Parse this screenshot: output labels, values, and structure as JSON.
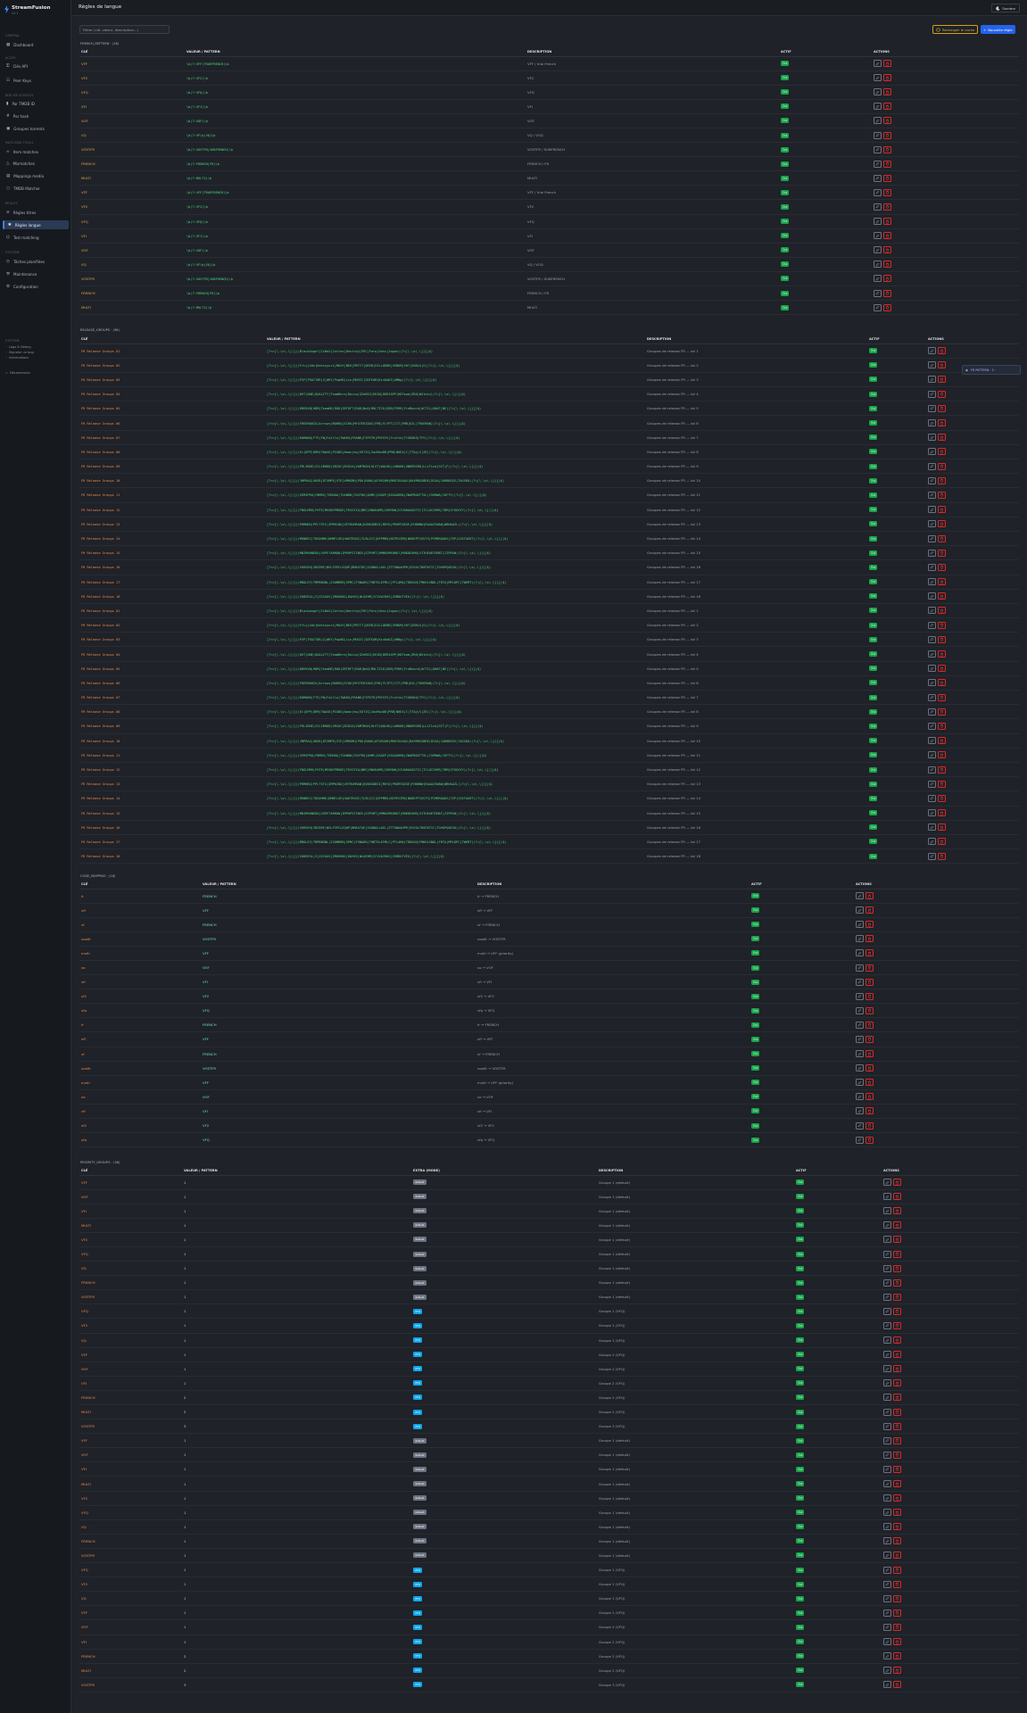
{
  "app": {
    "name": "StreamFusion",
    "version": "v2.1",
    "page_title": "Règles de langue",
    "theme_label": "Sombre"
  },
  "sidebar": {
    "sections": [
      {
        "label": "Général",
        "items": [
          {
            "label": "Dashboard",
            "icon": "dashboard-icon"
          }
        ]
      },
      {
        "label": "Accès",
        "items": [
          {
            "label": "Clés API",
            "icon": "key-icon"
          },
          {
            "label": "Peer Keys",
            "icon": "users-icon"
          }
        ]
      },
      {
        "label": "Bdd de sources",
        "items": [
          {
            "label": "Par TMDB ID",
            "icon": "film-icon"
          },
          {
            "label": "Par hash",
            "icon": "hash-icon"
          },
          {
            "label": "Groupes torrents",
            "icon": "box-icon"
          }
        ]
      },
      {
        "label": "Matching tools",
        "items": [
          {
            "label": "Item matches",
            "icon": "link-icon"
          },
          {
            "label": "Mismatches",
            "icon": "warning-icon"
          },
          {
            "label": "Mappings media",
            "icon": "map-icon"
          },
          {
            "label": "TMDB Matcher",
            "icon": "search-icon"
          }
        ]
      },
      {
        "label": "Règles",
        "items": [
          {
            "label": "Règles titres",
            "icon": "rule-icon"
          },
          {
            "label": "Règles langue",
            "icon": "language-icon",
            "active": true
          },
          {
            "label": "Test matching",
            "icon": "test-icon"
          }
        ]
      },
      {
        "label": "Système",
        "items": [
          {
            "label": "Tâches planifiées",
            "icon": "clock-icon"
          },
          {
            "label": "Maintenance",
            "icon": "wrench-icon"
          },
          {
            "label": "Configuration",
            "icon": "gear-icon"
          }
        ]
      }
    ],
    "footer_section": "Système",
    "footer_links": [
      "Logs & Debug",
      "Signaler un bug",
      "Informations"
    ],
    "logout": "Déconnexion"
  },
  "toolbar": {
    "filter_placeholder": "Filtrer (clé, valeur, description...)",
    "reload_label": "Recharger le cache",
    "new_label": "Nouvelle règle"
  },
  "floating": {
    "label": "FR PATTERN · 2 ·"
  },
  "french_pattern": {
    "title": "FRENCH_PATTERN · (18)",
    "headers": [
      "CLÉ",
      "VALEUR / PATTERN",
      "DESCRIPTION",
      "ACTIF",
      "ACTIONS"
    ],
    "rows": [
      [
        "VFF",
        "\\b(?:VFF|TRUEFRENCH)\\b",
        "VFF / Vrai French",
        "Oui"
      ],
      [
        "VF2",
        "\\b(?:VF2)\\b",
        "VF2",
        "Oui"
      ],
      [
        "VFQ",
        "\\b(?:VFQ)\\b",
        "VFQ",
        "Oui"
      ],
      [
        "VFI",
        "\\b(?:VFI)\\b",
        "VFI",
        "Oui"
      ],
      [
        "VOF",
        "\\b(?:VOF)\\b",
        "VOF",
        "Oui"
      ],
      [
        "VQ",
        "\\b(?:VF\\b|VQ)\\b",
        "VQ / VOQ",
        "Oui"
      ],
      [
        "VOSTFR",
        "\\b(?:VOSTFR|SUBFRENCH)\\b",
        "VOSTFR / SUBFRENCH",
        "Oui"
      ],
      [
        "FRENCH",
        "\\b(?:FRENCH|FR)\\b",
        "FRENCH / FR",
        "Oui"
      ],
      [
        "MULTI",
        "\\b(?:MULTI)\\b",
        "MULTI",
        "Oui"
      ],
      [
        "VFF",
        "\\b(?:VFF|TRUEFRENCH)\\b",
        "VFF / Vrai French",
        "Oui"
      ],
      [
        "VF2",
        "\\b(?:VF2)\\b",
        "VF2",
        "Oui"
      ],
      [
        "VFQ",
        "\\b(?:VFQ)\\b",
        "VFQ",
        "Oui"
      ],
      [
        "VFI",
        "\\b(?:VFI)\\b",
        "VFI",
        "Oui"
      ],
      [
        "VOF",
        "\\b(?:VOF)\\b",
        "VOF",
        "Oui"
      ],
      [
        "VQ",
        "\\b(?:VF\\b|VQ)\\b",
        "VQ / VOQ",
        "Oui"
      ],
      [
        "VOSTFR",
        "\\b(?:VOSTFR|SUBFRENCH)\\b",
        "VOSTFR / SUBFRENCH",
        "Oui"
      ],
      [
        "FRENCH",
        "\\b(?:FRENCH|FR)\\b",
        "FRENCH / FR",
        "Oui"
      ],
      [
        "MULTI",
        "\\b(?:MULTI)\\b",
        "MULTI",
        "Oui"
      ]
    ]
  },
  "release_groups": {
    "title": "RELEASE_GROUPS · (36)",
    "headers": [
      "CLÉ",
      "VALEUR / PATTERN",
      "DESCRIPTION",
      "ACTIF",
      "ACTIONS"
    ],
    "rows": [
      [
        "FR Release Groups 01",
        "[?<=[\\.\\s\\-\\[(])(BlackAngel|CiNeX|Cortex|Destroy|FRC|Fero|Genz|Japon)(?=[\\.\\s\\-\\])]|$)",
        "Groupes de release FR — lot 1",
        "Oui"
      ],
      [
        "FR Release Groups 02",
        "[?<=[\\.\\s\\-\\[(])(FrLy|Gdn|Katsuyuri|MAXY|NEO|PRTCT|QEEB|SILLQEBB|VENUM|SHT|XORiG|S)(?=[\\.\\s\\-\\])]|$)",
        "Groupes de release FR — lot 2",
        "Oui"
      ],
      [
        "FR Release Groups 03",
        "[?<=[\\.\\s\\-\\[(])(P2P|TRAIT0R|Z|WKY|PopHD|Lin|MUSIC|SDTEAM|KisKaDI|AMNg)(?=[\\.\\s\\-\\])]|$)",
        "Groupes de release FR — lot 3",
        "Oui"
      ],
      [
        "FR Release Groups 04",
        "[?<=[\\.\\s\\-\\[(])(DHT|ONE|QUALITY|TeamBers|Rocco|GZeBIX|EKIN|DERIAPP|HDTeam|ZRO|WStein)(?=[\\.\\s\\-\\])]|$)",
        "Groupes de release FR — lot 4",
        "Oui"
      ],
      [
        "FR Release Groups 05",
        "[?<=[\\.\\s\\-\\[(])(DREKVN|HDM|TeamHD|ROD|GRTDFT|RAR|NeO|MULTICO|SDB|PVRR|FreBoard|ACTIL|ONAT|NE)(?=[\\.\\s\\-\\])]|$)",
        "Groupes de release FR — lot 5",
        "Oui"
      ],
      [
        "FR Release Groups 06",
        "[?<=[\\.\\s\\-\\[(])(FREEMARIO|Arrows|MARRQ|ECHO|MYSTERIOUS|FME|FLYPT|CIT|FMB|DIL|TRUEMAN)(?=[\\.\\s\\-\\])]|$)",
        "Groupes de release FR — lot 6",
        "Oui"
      ],
      [
        "FR Release Groups 07",
        "[?<=[\\.\\s\\-\\[(])(ROMANO|FTS|FW|Faillo|TWAKO|FRANK|FIPSTR|PHYSYS|Frutta|TIGKOKO|TFS)(?=[\\.\\s\\-\\])]|$)",
        "Groupes de release FR — lot 7",
        "Oui"
      ],
      [
        "FR Release Groups 08",
        "[?<=[\\.\\s\\-\\[(])(Ec|DPP|DRM|TWASK|PIGBO|Amanjew|EOTIG|ZaxMonDB|PRB|NHEX|C|TTAy|S|ZE)(?=[\\.\\s\\-\\])]|$)",
        "Groupes de release FR — lot 8",
        "Oui"
      ],
      [
        "FR Release Groups 09",
        "[?<=[\\.\\s\\-\\[(])(FRLIBOE|CCLIBHDD|GRIOC|BCDIA|VAMTNSH|ULVT|WOLHO|LAMANE|UNDERGRD|LLLTLnd|SIT|F)(?=[\\.\\s\\-\\])]|$)",
        "Groupes de release FR — lot 9",
        "Oui"
      ],
      [
        "FR Release Groups 10",
        "[?<=[\\.\\s\\-\\[(])(JMPRAX|ARGR|DTXMPE|GTE|VMRGBH|PDO|RANG|AFVRZAM|RMOTAVAQX|RAYMRXXBDE|DCOA|CARBBSEX|TAGSDO)(?=[\\.\\s\\-\\])]|$)",
        "Groupes de release FR — lot 10",
        "Oui"
      ],
      [
        "FR Release Groups 11",
        "[?<=[\\.\\s\\-\\[(])(SEMIPRO|FNMRS|TGMUOA|TSANDN|TOXTRO|AHMS|SXAEP|SEAGARMA|ZWAPBOGTTXL|CSHMWA|COFTY)(?=[\\.\\s\\-\\])]|$)",
        "Groupes de release FR — lot 11",
        "Oui"
      ],
      [
        "FR Release Groups 12",
        "[?<=[\\.\\s\\-\\[(])(FNGLMRR|FHTE|MEGNYPMODE|TRIGYIA|NMC|RNGKAMR|CHEMAN|VIVARAGASTIC|TCLUCCHMS|TBM|STUGGYY)(?=[\\.\\s\\-\\])]|$)",
        "Groupes de release FR — lot 12",
        "Oui"
      ],
      [
        "FR Release Groups 13",
        "[?<=[\\.\\s\\-\\[(])(PHMHBX|PPLTSTX|IMPKCNQ|VETHUHRAW|QVDKGDBSI|MUYO|PRUMTAEGE|FHNHBW|RAAACEWAW|WBHAAZL)(?=[\\.\\s\\-\\])]|$)",
        "Groupes de release FR — lot 13",
        "Oui"
      ],
      [
        "FR Release Groups 14",
        "[?<=[\\.\\s\\-\\[(])(MUNDEC|TDGOHMO|OMNTLGR|HAKTRVOI|TLBLCCI|DFPMRU|NCPEVZMU|NODEPTCOVTS|PCMRRQAHX|TEP|CUSTAGHT)(?=[\\.\\s\\-\\])]|$)",
        "Groupes de release FR — lot 14",
        "Oui"
      ],
      [
        "FR Release Groups 15",
        "[?<=[\\.\\s\\-\\[(])(MNIRMUNEDO|VGPETARMAN|IMPOPSTINSV|SZPVMT|VMMAVMEOMAT|MOKDEAMO|VITHEARTSMAT|ZIPRSW)(?=[\\.\\s\\-\\])]|$)",
        "Groupes de release FR — lot 15",
        "Oui"
      ],
      [
        "FR Release Groups 16",
        "[?<=[\\.\\s\\-\\[(])(VUDVEH|SBCDRF|NSLFSPCLEQOP|BMAXTOE|SGONOLLAEL|ZTTONAAHPR|SSVOLTNSPATIC|TOVKPQAESO)(?=[\\.\\s\\-\\])]|$)",
        "Groupes de release FR — lot 16",
        "Oui"
      ],
      [
        "FR Release Groups 17",
        "[?<=[\\.\\s\\-\\[(])(MBOLEY|TMPBBGNL|ISOMBRB|SPMC|FSNAHR|THBTSLEFMLC|PTLAMA|TDRUGH|FMKHLSNDL|FRTA|MPLDPC|TWEMT)(?=[\\.\\s\\-\\])]|$)",
        "Groupes de release FR — lot 17",
        "Oui"
      ],
      [
        "FR Release Groups 18",
        "[?<=[\\.\\s\\-\\[(])(SUBSEGL|Z|ZXCAUS|ZMUUMAS|DAHVS|WLUEHM|CCVVAIRUS|ZXMDUTVEU)(?=[\\.\\s\\-\\])]|$)",
        "Groupes de release FR — lot 18",
        "Oui"
      ],
      [
        "FR Release Groups 01",
        "[?<=[\\.\\s\\-\\[(])(BlackAngel|CiNeX|Cortex|Destroy|FRC|Fero|Genz|Japon)(?=[\\.\\s\\-\\])]|$)",
        "Groupes de release FR — lot 1",
        "Oui"
      ],
      [
        "FR Release Groups 02",
        "[?<=[\\.\\s\\-\\[(])(FrLy|Gdn|Katsuyuri|MAXY|NEO|PRTCT|QEEB|SILLQEBB|VENUM|SHT|XORiG|S)(?=[\\.\\s\\-\\])]|$)",
        "Groupes de release FR — lot 2",
        "Oui"
      ],
      [
        "FR Release Groups 03",
        "[?<=[\\.\\s\\-\\[(])(P2P|TRAIT0R|Z|WKY|PopHD|Lin|MUSIC|SDTEAM|KisKaDI|AMNg)(?=[\\.\\s\\-\\])]|$)",
        "Groupes de release FR — lot 3",
        "Oui"
      ],
      [
        "FR Release Groups 04",
        "[?<=[\\.\\s\\-\\[(])(DHT|ONE|QUALITY|TeamBers|Rocco|GZeBIX|EKIN|DERIAPP|HDTeam|ZRO|WStein)(?=[\\.\\s\\-\\])]|$)",
        "Groupes de release FR — lot 4",
        "Oui"
      ],
      [
        "FR Release Groups 05",
        "[?<=[\\.\\s\\-\\[(])(DREKVN|HDM|TeamHD|ROD|GRTDFT|RAR|NeO|MULTICO|SDB|PVRR|FreBoard|ACTIL|ONAT|NE)(?=[\\.\\s\\-\\])]|$)",
        "Groupes de release FR — lot 5",
        "Oui"
      ],
      [
        "FR Release Groups 06",
        "[?<=[\\.\\s\\-\\[(])(FREEMARIO|Arrows|MARRQ|ECHO|MYSTERIOUS|FME|FLYPT|CIT|FMB|DIL|TRUEMAN)(?=[\\.\\s\\-\\])]|$)",
        "Groupes de release FR — lot 6",
        "Oui"
      ],
      [
        "FR Release Groups 07",
        "[?<=[\\.\\s\\-\\[(])(ROMANO|FTS|FW|Faillo|TWAKO|FRANK|FIPSTR|PHYSYS|Frutta|TIGKOKO|TFS)(?=[\\.\\s\\-\\])]|$)",
        "Groupes de release FR — lot 7",
        "Oui"
      ],
      [
        "FR Release Groups 08",
        "[?<=[\\.\\s\\-\\[(])(Ec|DPP|DRM|TWASK|PIGBO|Amanjew|EOTIG|ZaxMonDB|PRB|NHEX|C|TTAy|S|ZE)(?=[\\.\\s\\-\\])]|$)",
        "Groupes de release FR — lot 8",
        "Oui"
      ],
      [
        "FR Release Groups 09",
        "[?<=[\\.\\s\\-\\[(])(FRLIBOE|CCLIBHDD|GRIOC|BCDIA|VAMTNSH|ULVT|WOLHO|LAMANE|UNDERGRD|LLLTLnd|SIT|F)(?=[\\.\\s\\-\\])]|$)",
        "Groupes de release FR — lot 9",
        "Oui"
      ],
      [
        "FR Release Groups 10",
        "[?<=[\\.\\s\\-\\[(])(JMPRAX|ARGR|DTXMPE|GTE|VMRGBH|PDO|RANG|AFVRZAM|RMOTAVAQX|RAYMRXXBDE|DCOA|CARBBSEX|TAGSDO)(?=[\\.\\s\\-\\])]|$)",
        "Groupes de release FR — lot 10",
        "Oui"
      ],
      [
        "FR Release Groups 11",
        "[?<=[\\.\\s\\-\\[(])(SEMIPRO|FNMRS|TGMUOA|TSANDN|TOXTRO|AHMS|SXAEP|SEAGARMA|ZWAPBOGTTXL|CSHMWA|COFTY)(?=[\\.\\s\\-\\])]|$)",
        "Groupes de release FR — lot 11",
        "Oui"
      ],
      [
        "FR Release Groups 12",
        "[?<=[\\.\\s\\-\\[(])(FNGLMRR|FHTE|MEGNYPMODE|TRIGYIA|NMC|RNGKAMR|CHEMAN|VIVARAGASTIC|TCLUCCHMS|TBM|STUGGYY)(?=[\\.\\s\\-\\])]|$)",
        "Groupes de release FR — lot 12",
        "Oui"
      ],
      [
        "FR Release Groups 13",
        "[?<=[\\.\\s\\-\\[(])(PHMHBX|PPLTSTX|IMPKCNQ|VETHUHRAW|QVDKGDBSI|MUYO|PRUMTAEGE|FHNHBW|RAAACEWAW|WBHAAZL)(?=[\\.\\s\\-\\])]|$)",
        "Groupes de release FR — lot 13",
        "Oui"
      ],
      [
        "FR Release Groups 14",
        "[?<=[\\.\\s\\-\\[(])(MUNDEC|TDGOHMO|OMNTLGR|HAKTRVOI|TLBLCCI|DFPMRU|NCPEVZMU|NODEPTCOVTS|PCMRRQAHX|TEP|CUSTAGHT)(?=[\\.\\s\\-\\])]|$)",
        "Groupes de release FR — lot 14",
        "Oui"
      ],
      [
        "FR Release Groups 15",
        "[?<=[\\.\\s\\-\\[(])(MNIRMUNEDO|VGPETARMAN|IMPOPSTINSV|SZPVMT|VMMAVMEOMAT|MOKDEAMO|VITHEARTSMAT|ZIPRSW)(?=[\\.\\s\\-\\])]|$)",
        "Groupes de release FR — lot 15",
        "Oui"
      ],
      [
        "FR Release Groups 16",
        "[?<=[\\.\\s\\-\\[(])(VUDVEH|SBCDRF|NSLFSPCLEQOP|BMAXTOE|SGONOLLAEL|ZTTONAAHPR|SSVOLTNSPATIC|TOVKPQAESO)(?=[\\.\\s\\-\\])]|$)",
        "Groupes de release FR — lot 16",
        "Oui"
      ],
      [
        "FR Release Groups 17",
        "[?<=[\\.\\s\\-\\[(])(MBOLEY|TMPBBGNL|ISOMBRB|SPMC|FSNAHR|THBTSLEFMLC|PTLAMA|TDRUGH|FMKHLSNDL|FRTA|MPLDPC|TWEMT)(?=[\\.\\s\\-\\])]|$)",
        "Groupes de release FR — lot 17",
        "Oui"
      ],
      [
        "FR Release Groups 18",
        "[?<=[\\.\\s\\-\\[(])(SUBSEGL|Z|ZXCAUS|ZMUUMAS|DAHVS|WLUEHM|CCVVAIRUS|ZXMDUTVEU)(?=[\\.\\s\\-\\])]|$)",
        "Groupes de release FR — lot 18",
        "Oui"
      ]
    ]
  },
  "code_mapping": {
    "title": "CODE_MAPPING · (18)",
    "headers": [
      "CLÉ",
      "VALEUR / PATTERN",
      "DESCRIPTION",
      "ACTIF",
      "ACTIONS"
    ],
    "rows": [
      [
        "fr",
        "FRENCH",
        "fr → FRENCH",
        "Oui"
      ],
      [
        "vff",
        "VFF",
        "vff → VFF",
        "Oui"
      ],
      [
        "vf",
        "FRENCH",
        "vf → FRENCH",
        "Oui"
      ],
      [
        "vostfr",
        "VOSTFR",
        "vostfr → VOSTFR",
        "Oui"
      ],
      [
        "multi",
        "VFF",
        "multi → VFF (priority)",
        "Oui"
      ],
      [
        "vo",
        "VOF",
        "vo → VOF",
        "Oui"
      ],
      [
        "vfi",
        "VFI",
        "vfi → VFI",
        "Oui"
      ],
      [
        "vf2",
        "VF2",
        "vf2 → VF2",
        "Oui"
      ],
      [
        "vfq",
        "VFQ",
        "vfq → VFQ",
        "Oui"
      ],
      [
        "fr",
        "FRENCH",
        "fr → FRENCH",
        "Oui"
      ],
      [
        "vff",
        "VFF",
        "vff → VFF",
        "Oui"
      ],
      [
        "vf",
        "FRENCH",
        "vf → FRENCH",
        "Oui"
      ],
      [
        "vostfr",
        "VOSTFR",
        "vostfr → VOSTFR",
        "Oui"
      ],
      [
        "multi",
        "VFF",
        "multi → VFF (priority)",
        "Oui"
      ],
      [
        "vo",
        "VOF",
        "vo → VOF",
        "Oui"
      ],
      [
        "vfi",
        "VFI",
        "vfi → VFI",
        "Oui"
      ],
      [
        "vf2",
        "VF2",
        "vf2 → VF2",
        "Oui"
      ],
      [
        "vfq",
        "VFQ",
        "vfq → VFQ",
        "Oui"
      ]
    ]
  },
  "priority_groups": {
    "title": "PRIORITY_GROUPS · (36)",
    "headers": [
      "CLÉ",
      "VALEUR / PATTERN",
      "EXTRA (MODE)",
      "DESCRIPTION",
      "ACTIF",
      "ACTIONS"
    ],
    "rows": [
      [
        "VFF",
        "1",
        "default",
        "Groupe 1 (default)",
        "Oui"
      ],
      [
        "VOF",
        "1",
        "default",
        "Groupe 1 (default)",
        "Oui"
      ],
      [
        "VFI",
        "1",
        "default",
        "Groupe 1 (default)",
        "Oui"
      ],
      [
        "MULTI",
        "1",
        "default",
        "Groupe 1 (default)",
        "Oui"
      ],
      [
        "VF2",
        "1",
        "default",
        "Groupe 1 (default)",
        "Oui"
      ],
      [
        "VFQ",
        "1",
        "default",
        "Groupe 1 (default)",
        "Oui"
      ],
      [
        "VQ",
        "1",
        "default",
        "Groupe 1 (default)",
        "Oui"
      ],
      [
        "FRENCH",
        "1",
        "default",
        "Groupe 1 (default)",
        "Oui"
      ],
      [
        "VOSTFR",
        "1",
        "default",
        "Groupe 1 (default)",
        "Oui"
      ],
      [
        "VFQ",
        "1",
        "VFQ",
        "Groupe 1 (VFQ)",
        "Oui"
      ],
      [
        "VF2",
        "1",
        "VFQ",
        "Groupe 1 (VFQ)",
        "Oui"
      ],
      [
        "VQ",
        "1",
        "VFQ",
        "Groupe 1 (VFQ)",
        "Oui"
      ],
      [
        "VFF",
        "1",
        "VFQ",
        "Groupe 2 (VFQ)",
        "Oui"
      ],
      [
        "VOF",
        "1",
        "VFQ",
        "Groupe 2 (VFQ)",
        "Oui"
      ],
      [
        "VFI",
        "1",
        "VFQ",
        "Groupe 2 (VFQ)",
        "Oui"
      ],
      [
        "FRENCH",
        "2",
        "VFQ",
        "Groupe 2 (VFQ)",
        "Oui"
      ],
      [
        "MULTI",
        "2",
        "VFQ",
        "Groupe 2 (VFQ)",
        "Oui"
      ],
      [
        "VOSTFR",
        "3",
        "VFQ",
        "Groupe 3 (VFQ)",
        "Oui"
      ],
      [
        "VFF",
        "1",
        "default",
        "Groupe 1 (default)",
        "Oui"
      ],
      [
        "VOF",
        "1",
        "default",
        "Groupe 1 (default)",
        "Oui"
      ],
      [
        "VFI",
        "1",
        "default",
        "Groupe 1 (default)",
        "Oui"
      ],
      [
        "MULTI",
        "1",
        "default",
        "Groupe 1 (default)",
        "Oui"
      ],
      [
        "VF2",
        "1",
        "default",
        "Groupe 1 (default)",
        "Oui"
      ],
      [
        "VFQ",
        "1",
        "default",
        "Groupe 1 (default)",
        "Oui"
      ],
      [
        "VQ",
        "1",
        "default",
        "Groupe 1 (default)",
        "Oui"
      ],
      [
        "FRENCH",
        "1",
        "default",
        "Groupe 1 (default)",
        "Oui"
      ],
      [
        "VOSTFR",
        "1",
        "default",
        "Groupe 1 (default)",
        "Oui"
      ],
      [
        "VFQ",
        "1",
        "VFQ",
        "Groupe 1 (VFQ)",
        "Oui"
      ],
      [
        "VF2",
        "1",
        "VFQ",
        "Groupe 1 (VFQ)",
        "Oui"
      ],
      [
        "VQ",
        "1",
        "VFQ",
        "Groupe 1 (VFQ)",
        "Oui"
      ],
      [
        "VFF",
        "1",
        "VFQ",
        "Groupe 2 (VFQ)",
        "Oui"
      ],
      [
        "VOF",
        "1",
        "VFQ",
        "Groupe 2 (VFQ)",
        "Oui"
      ],
      [
        "VFI",
        "1",
        "VFQ",
        "Groupe 2 (VFQ)",
        "Oui"
      ],
      [
        "FRENCH",
        "2",
        "VFQ",
        "Groupe 2 (VFQ)",
        "Oui"
      ],
      [
        "MULTI",
        "2",
        "VFQ",
        "Groupe 2 (VFQ)",
        "Oui"
      ],
      [
        "VOSTFR",
        "3",
        "VFQ",
        "Groupe 3 (VFQ)",
        "Oui"
      ]
    ]
  }
}
